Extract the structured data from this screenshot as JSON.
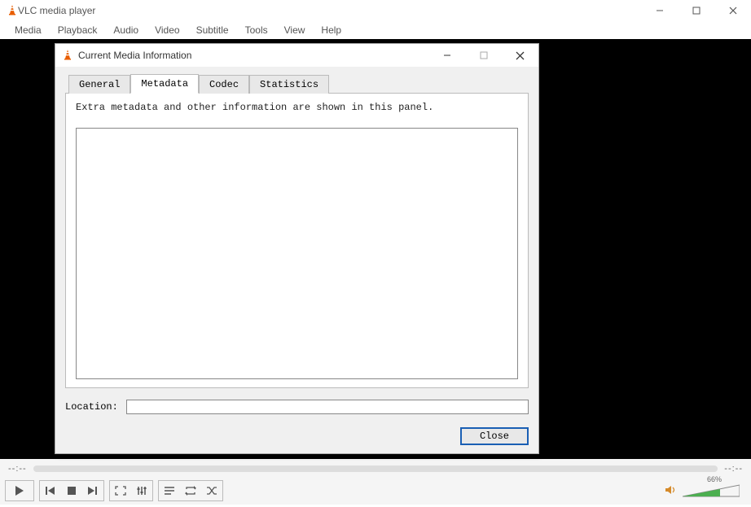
{
  "app": {
    "title": "VLC media player"
  },
  "menubar": {
    "items": [
      "Media",
      "Playback",
      "Audio",
      "Video",
      "Subtitle",
      "Tools",
      "View",
      "Help"
    ]
  },
  "dialog": {
    "title": "Current Media Information",
    "tabs": {
      "general": "General",
      "metadata": "Metadata",
      "codec": "Codec",
      "statistics": "Statistics"
    },
    "pane_desc": "Extra metadata and other information are shown in this panel.",
    "location_label": "Location:",
    "location_value": "",
    "close_label": "Close"
  },
  "player": {
    "time_left": "--:--",
    "time_right": "--:--",
    "volume_pct": "66%"
  }
}
